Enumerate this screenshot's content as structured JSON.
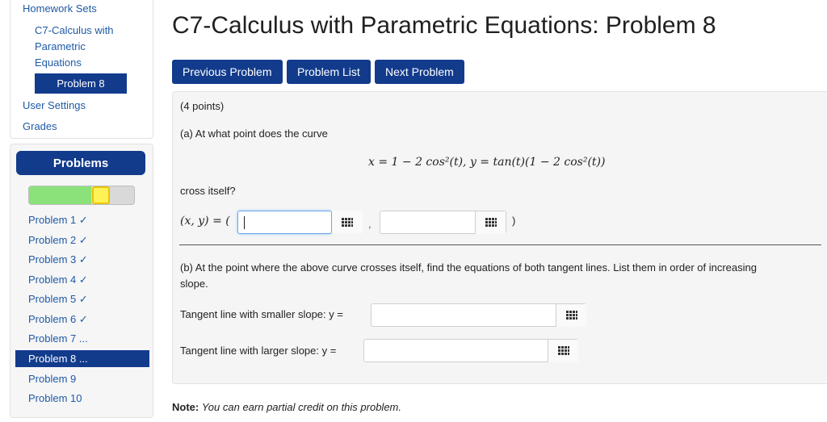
{
  "nav": {
    "homework_sets": "Homework Sets",
    "set_name_line1": "C7-Calculus with",
    "set_name_line2": "Parametric",
    "set_name_line3": "Equations",
    "current_problem": "Problem 8",
    "user_settings": "User Settings",
    "grades": "Grades"
  },
  "problems_panel": {
    "header": "Problems",
    "progress": {
      "correct_fraction": 0.6,
      "partial_fraction": 0.1
    },
    "items": [
      {
        "label": "Problem 1 ✓"
      },
      {
        "label": "Problem 2 ✓"
      },
      {
        "label": "Problem 3 ✓"
      },
      {
        "label": "Problem 4 ✓"
      },
      {
        "label": "Problem 5 ✓"
      },
      {
        "label": "Problem 6 ✓"
      },
      {
        "label": "Problem 7 ..."
      },
      {
        "label": "Problem 8 ..."
      },
      {
        "label": "Problem 9"
      },
      {
        "label": "Problem 10"
      }
    ]
  },
  "page_title": "C7-Calculus with Parametric Equations: Problem 8",
  "buttons": {
    "previous": "Previous Problem",
    "list": "Problem List",
    "next": "Next Problem"
  },
  "problem": {
    "points": "(4 points)",
    "part_a": "(a) At what point does the curve",
    "equation": "x = 1 − 2 cos²(t),   y = tan(t)(1 − 2 cos²(t))",
    "cross_itself": "cross itself?",
    "xy_label": "(x, y) = (",
    "comma": ",",
    "close_paren": ")",
    "part_b_line1": "(b) At the point where the above curve crosses itself, find the equations of both tangent lines. List them in order of increasing",
    "part_b_line2": "slope.",
    "smaller_label": "Tangent line with smaller slope: y =",
    "larger_label": "Tangent line with larger slope: y ="
  },
  "inputs": {
    "x_value": "",
    "y_value": "",
    "smaller_slope_value": "",
    "larger_slope_value": ""
  },
  "note_label": "Note:",
  "note_text": "You can earn partial credit on this problem."
}
